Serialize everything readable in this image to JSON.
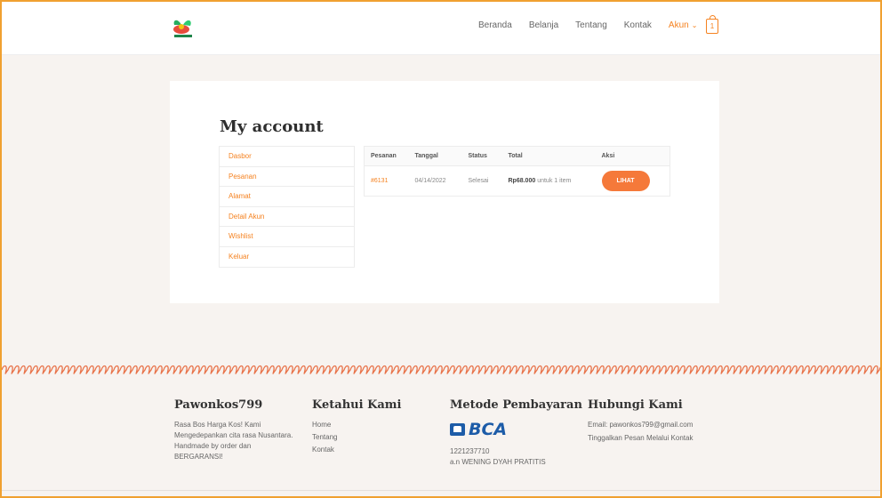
{
  "nav": {
    "items": [
      "Beranda",
      "Belanja",
      "Tentang",
      "Kontak"
    ],
    "account": "Akun",
    "cart_count": "1"
  },
  "page": {
    "title": "My account"
  },
  "sidebar": {
    "items": [
      "Dasbor",
      "Pesanan",
      "Alamat",
      "Detail Akun",
      "Wishlist",
      "Keluar"
    ]
  },
  "orders": {
    "headers": [
      "Pesanan",
      "Tanggal",
      "Status",
      "Total",
      "Aksi"
    ],
    "rows": [
      {
        "number": "#6131",
        "date": "04/14/2022",
        "status": "Selesai",
        "amount": "Rp68.000",
        "items_note": "untuk 1 item",
        "action": "LIHAT"
      }
    ]
  },
  "footer": {
    "about": {
      "title": "Pawonkos799",
      "text": "Rasa Bos Harga Kos! Kami Mengedepankan cita rasa Nusantara. Handmade by order dan BERGARANSI!"
    },
    "links": {
      "title": "Ketahui Kami",
      "items": [
        "Home",
        "Tentang",
        "Kontak"
      ]
    },
    "payment": {
      "title": "Metode Pembayaran",
      "bank": "BCA",
      "account_number": "1221237710",
      "account_name": "a.n WENING DYAH PRATITIS"
    },
    "contact": {
      "title": "Hubungi Kami",
      "email": "Email: pawonkos799@gmail.com",
      "note": "Tinggalkan Pesan Melalui Kontak"
    }
  },
  "colors": {
    "accent": "#f58220",
    "button": "#f5793a",
    "bca_blue": "#1d5ca8",
    "frame": "#f0a030"
  }
}
